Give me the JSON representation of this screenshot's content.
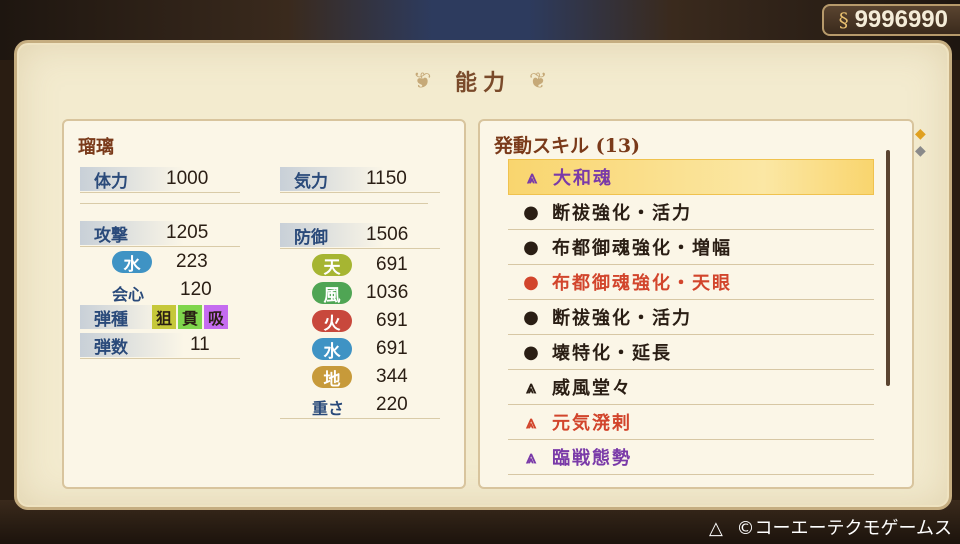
{
  "currency": {
    "icon": "coin-icon",
    "amount": "9996990"
  },
  "title": "能力",
  "character": {
    "name": "瑠璃",
    "stats": {
      "hp_label": "体力",
      "hp": "1000",
      "stamina_label": "気力",
      "stamina": "1150",
      "attack_label": "攻撃",
      "attack": "1205",
      "defense_label": "防御",
      "defense": "1506",
      "element_label": "水",
      "element_value": "223",
      "crit_label": "会心",
      "crit": "120",
      "ammo_label": "弾種",
      "ammo_types": [
        "狙",
        "貫",
        "吸"
      ],
      "ammo_count_label": "弾数",
      "ammo_count": "11",
      "resistances": [
        {
          "label": "天",
          "value": "691",
          "color": "#a6b532"
        },
        {
          "label": "風",
          "value": "1036",
          "color": "#4fa554"
        },
        {
          "label": "火",
          "value": "691",
          "color": "#c8483c"
        },
        {
          "label": "水",
          "value": "691",
          "color": "#3f93c4"
        },
        {
          "label": "地",
          "value": "344",
          "color": "#c79a3a"
        }
      ],
      "weight_label": "重さ",
      "weight": "220"
    }
  },
  "skills": {
    "heading": "発動スキル (13)",
    "items": [
      {
        "name": "大和魂",
        "icon": "chevron-up-icon",
        "color": "#7a3aa8",
        "selected": true
      },
      {
        "name": "断祓強化・活力",
        "icon": "circle-swirl-icon",
        "color": "#2a1e14",
        "selected": false
      },
      {
        "name": "布都御魂強化・増幅",
        "icon": "circle-swirl-icon",
        "color": "#2a1e14",
        "selected": false
      },
      {
        "name": "布都御魂強化・天眼",
        "icon": "circle-swirl-icon",
        "color": "#d2452c",
        "selected": false
      },
      {
        "name": "断祓強化・活力",
        "icon": "circle-swirl-icon",
        "color": "#2a1e14",
        "selected": false
      },
      {
        "name": "壊特化・延長",
        "icon": "circle-swirl-icon",
        "color": "#2a1e14",
        "selected": false
      },
      {
        "name": "威風堂々",
        "icon": "chevron-up-icon",
        "color": "#2a1e14",
        "selected": false
      },
      {
        "name": "元気溌剌",
        "icon": "chevron-up-icon",
        "color": "#d2452c",
        "selected": false
      },
      {
        "name": "臨戦態勢",
        "icon": "chevron-up-icon",
        "color": "#7a3aa8",
        "selected": false
      }
    ]
  },
  "footer": {
    "icon": "triangle-button-icon",
    "copyright": "©コーエーテクモゲームス"
  }
}
